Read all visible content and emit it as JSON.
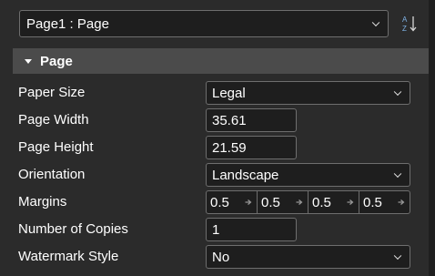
{
  "selector": {
    "value": "Page1 : Page"
  },
  "category": {
    "label": "Page"
  },
  "properties": {
    "paper_size": {
      "label": "Paper Size",
      "value": "Legal"
    },
    "page_width": {
      "label": "Page Width",
      "value": "35.61"
    },
    "page_height": {
      "label": "Page Height",
      "value": "21.59"
    },
    "orientation": {
      "label": "Orientation",
      "value": "Landscape"
    },
    "margins": {
      "label": "Margins",
      "values": [
        "0.5",
        "0.5",
        "0.5",
        "0.5"
      ]
    },
    "copies": {
      "label": "Number of Copies",
      "value": "1"
    },
    "watermark": {
      "label": "Watermark Style",
      "value": "No"
    }
  },
  "icons": {
    "sort": "sort-alphabetical-icon",
    "dropdown": "chevron-down-icon",
    "expand": "triangle-down-icon",
    "margin_side": "arrow-right-icon"
  },
  "colors": {
    "background": "#2b2b2b",
    "field": "#1e1e1e",
    "border": "#6e6e6e",
    "category": "#4b4b4b",
    "accent": "#7fb2e5"
  }
}
